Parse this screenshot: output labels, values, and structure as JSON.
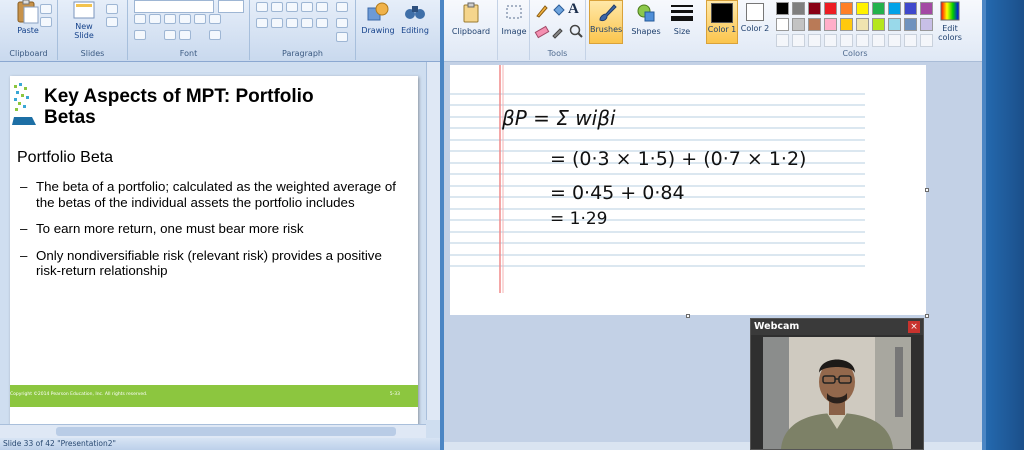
{
  "ppt": {
    "ribbon": {
      "clipboard": {
        "paste_label": "Paste",
        "group_label": "Clipboard"
      },
      "slides": {
        "new_slide_label": "New Slide",
        "group_label": "Slides"
      },
      "font": {
        "group_label": "Font"
      },
      "paragraph": {
        "group_label": "Paragraph"
      },
      "drawing_label": "Drawing",
      "editing_label": "Editing"
    },
    "slide": {
      "title": "Key Aspects of MPT: Portfolio Betas",
      "heading": "Portfolio Beta",
      "bullets": [
        "The beta of a portfolio; calculated as the weighted average of the betas of the individual assets the portfolio includes",
        "To earn more return, one must bear more risk",
        "Only nondiversifiable risk (relevant risk) provides a positive risk-return relationship"
      ],
      "footer_copyright": "Copyright ©2014 Pearson Education, Inc. All rights reserved.",
      "footer_page": "5-33"
    },
    "status": {
      "left": "Slide 33 of 42   \"Presentation2\""
    }
  },
  "paint": {
    "ribbon": {
      "clipboard_label": "Clipboard",
      "image_label": "Image",
      "tools_label": "Tools",
      "brushes_label": "Brushes",
      "shapes_label": "Shapes",
      "size_label": "Size",
      "color1_label": "Color 1",
      "color2_label": "Color 2",
      "colors_label": "Colors",
      "edit_colors_label": "Edit colors"
    },
    "palette": [
      "#000000",
      "#7f7f7f",
      "#880015",
      "#ed1c24",
      "#ff7f27",
      "#fff200",
      "#22b14c",
      "#00a2e8",
      "#3f48cc",
      "#a349a4",
      "#ffffff",
      "#c3c3c3",
      "#b97a57",
      "#ffaec9",
      "#ffc90e",
      "#efe4b0",
      "#b5e61d",
      "#99d9ea",
      "#7092be",
      "#c8bfe7"
    ],
    "handwriting": {
      "line1": "βP = Σ wiβi",
      "line2": "= (0·3 × 1·5) + (0·7 × 1·2)",
      "line3": "= 0·45 + 0·84",
      "line4": "= 1·29"
    }
  },
  "webcam": {
    "title": "Webcam",
    "close_label": "×"
  }
}
